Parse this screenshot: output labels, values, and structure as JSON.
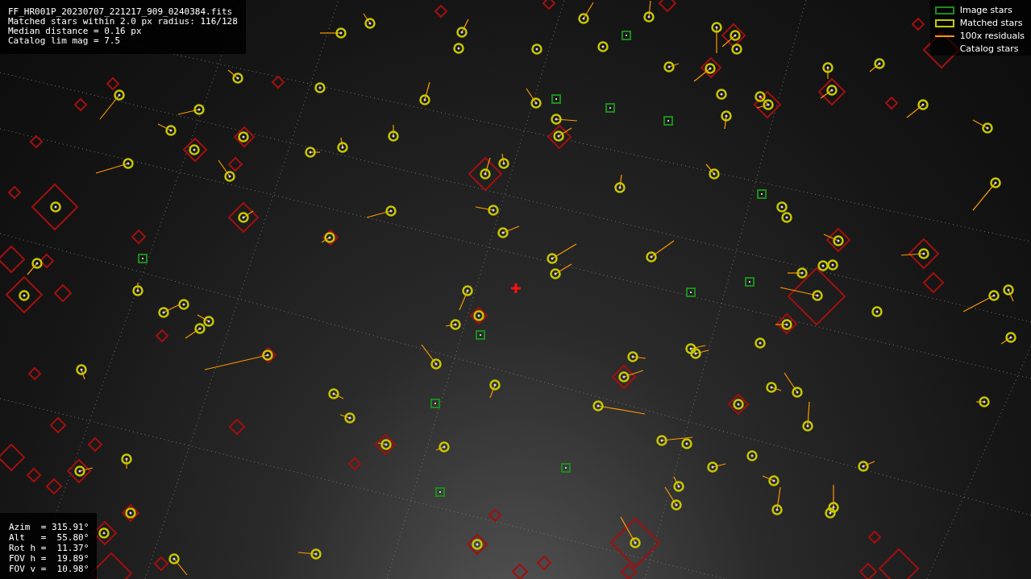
{
  "info": {
    "lines": [
      "FF_HR001P_20230707_221217_909_0240384.fits",
      "Matched stars within 2.0 px radius: 116/128",
      "Median distance = 0.16 px",
      "Catalog lim mag = 7.5"
    ]
  },
  "legend": [
    {
      "kind": "image",
      "label": "Image stars"
    },
    {
      "kind": "matched",
      "label": "Matched stars"
    },
    {
      "kind": "residual",
      "label": "100x residuals"
    },
    {
      "kind": "catalog",
      "label": "Catalog stars"
    }
  ],
  "pointing": {
    "lines": [
      "Azim  = 315.91°",
      "Alt   =  55.80°",
      "Rot h =  11.37°",
      "FOV h =  19.89°",
      "FOV v =  10.98°"
    ]
  }
}
